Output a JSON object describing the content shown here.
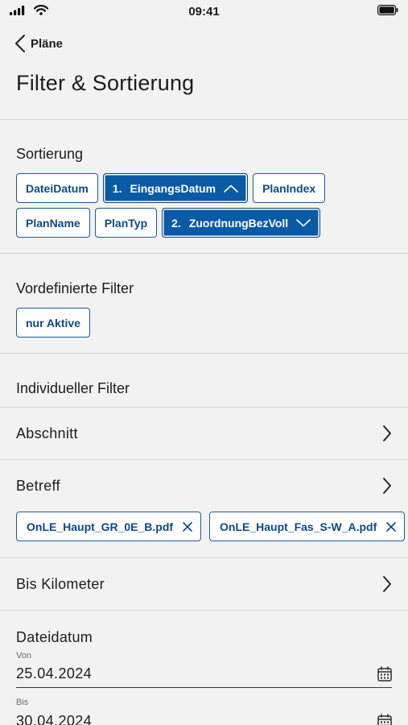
{
  "status_bar": {
    "time": "09:41"
  },
  "nav": {
    "back_label": "Pläne"
  },
  "page": {
    "title": "Filter & Sortierung"
  },
  "sorting": {
    "title": "Sortierung",
    "chips": [
      {
        "label": "DateiDatum",
        "active": false
      },
      {
        "label": "EingangsDatum",
        "active": true,
        "rank": "1.",
        "direction": "up"
      },
      {
        "label": "PlanIndex",
        "active": false
      },
      {
        "label": "PlanName",
        "active": false
      },
      {
        "label": "PlanTyp",
        "active": false
      },
      {
        "label": "ZuordnungBezVoll",
        "active": true,
        "rank": "2.",
        "direction": "down"
      }
    ]
  },
  "predefined": {
    "title": "Vordefinierte Filter",
    "chips": [
      {
        "label": "nur Aktive"
      }
    ]
  },
  "individual": {
    "title": "Individueller Filter",
    "abschnitt": "Abschnitt",
    "betreff": "Betreff",
    "betreff_tags": [
      "OnLE_Haupt_GR_0E_B.pdf",
      "OnLE_Haupt_Fas_S-W_A.pdf"
    ],
    "bis_kilometer": "Bis Kilometer"
  },
  "dateidatum": {
    "title": "Dateidatum",
    "von_label": "Von",
    "von_value": "25.04.2024",
    "bis_label": "Bis",
    "bis_value": "30.04.2024"
  },
  "colors": {
    "accent": "#0b5aa6",
    "chip_border": "#1a5a9a",
    "background": "#f2f2f2"
  },
  "icons": [
    "signal-icon",
    "wifi-icon",
    "battery-icon",
    "chevron-left-icon",
    "chevron-up-icon",
    "chevron-down-icon",
    "chevron-right-icon",
    "close-icon",
    "calendar-icon"
  ]
}
